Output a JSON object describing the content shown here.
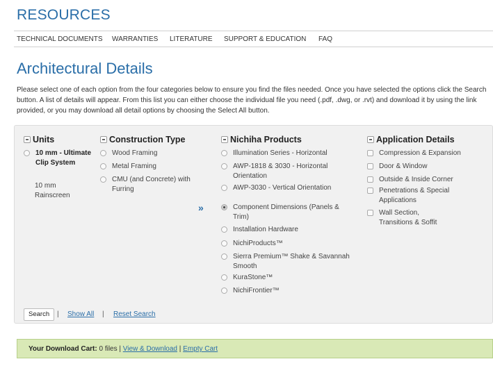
{
  "header": {
    "title": "RESOURCES"
  },
  "nav": {
    "items": [
      "TECHNICAL DOCUMENTS",
      "WARRANTIES",
      "LITERATURE",
      "SUPPORT & EDUCATION",
      "FAQ"
    ]
  },
  "page": {
    "title": "Architectural Details",
    "intro": "Please select one of each option from the four categories below to ensure you find the files needed. Once you have selected the options click the Search button. A list of details will appear. From this list you can either choose the individual file you need (.pdf, .dwg, or .rvt) and download it by using the link provided, or you may download all detail options by choosing the Select All button."
  },
  "units": {
    "heading": "Units",
    "options": [
      {
        "label": "10 mm - Ultimate Clip System",
        "selected": false,
        "bold": true
      }
    ],
    "sublabel": "10 mm Rainscreen"
  },
  "construction": {
    "heading": "Construction Type",
    "options": [
      {
        "label": "Wood Framing"
      },
      {
        "label": "Metal Framing"
      },
      {
        "label": "CMU (and Concrete) with Furring"
      }
    ]
  },
  "products": {
    "heading": "Nichiha Products",
    "options": [
      {
        "label": "Illumination Series - Horizontal",
        "selected": false
      },
      {
        "label": "AWP-1818 & 3030 - Horizontal Orientation",
        "selected": false
      },
      {
        "label": "AWP-3030 - Vertical Orientation",
        "selected": false
      },
      {
        "label": "Component Dimensions (Panels & Trim)",
        "selected": true
      },
      {
        "label": "Installation Hardware",
        "selected": false
      },
      {
        "label": "NichiProducts™",
        "selected": false
      },
      {
        "label": "Sierra Premium™ Shake & Savannah Smooth",
        "selected": false
      },
      {
        "label": "KuraStone™",
        "selected": false
      },
      {
        "label": "NichiFrontier™",
        "selected": false
      }
    ],
    "arrow": "»"
  },
  "application": {
    "heading": "Application Details",
    "options": [
      {
        "label": "Compression & Expansion"
      },
      {
        "label": "Door & Window"
      },
      {
        "label": "Outside & Inside Corner"
      },
      {
        "label": "Penetrations & Special Applications"
      },
      {
        "label": "Wall Section, Transitions & Soffit"
      }
    ]
  },
  "actions": {
    "search": "Search",
    "show_all": "Show All",
    "reset": "Reset Search",
    "separator": "|"
  },
  "cart": {
    "label": "Your Download Cart:",
    "count": "0 files",
    "separator": "|",
    "view_link": "View & Download",
    "empty_link": "Empty Cart"
  }
}
